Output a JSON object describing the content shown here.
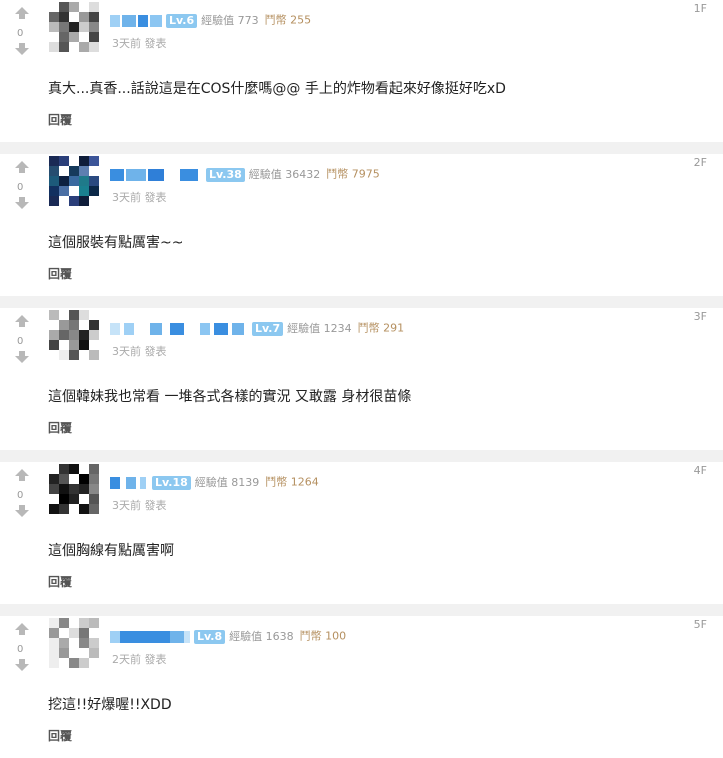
{
  "comments": [
    {
      "floor": "1F",
      "vote_count": "0",
      "level": "Lv.6",
      "exp_label": "經驗值 773",
      "gp_label": "鬥幣 255",
      "time": "3天前 發表",
      "text": "真大...真香...話說這是在COS什麼嗎@@ 手上的炸物看起來好像挺好吃xD",
      "reply": "回覆"
    },
    {
      "floor": "2F",
      "vote_count": "0",
      "level": "Lv.38",
      "exp_label": "經驗值 36432",
      "gp_label": "鬥幣 7975",
      "time": "3天前 發表",
      "text": "這個服裝有點厲害~~",
      "reply": "回覆"
    },
    {
      "floor": "3F",
      "vote_count": "0",
      "level": "Lv.7",
      "exp_label": "經驗值 1234",
      "gp_label": "鬥幣 291",
      "time": "3天前 發表",
      "text": "這個韓妹我也常看 一堆各式各樣的實況 又敢露 身材很苗條",
      "reply": "回覆"
    },
    {
      "floor": "4F",
      "vote_count": "0",
      "level": "Lv.18",
      "exp_label": "經驗值 8139",
      "gp_label": "鬥幣 1264",
      "time": "3天前 發表",
      "text": "這個胸線有點厲害啊",
      "reply": "回覆"
    },
    {
      "floor": "5F",
      "vote_count": "0",
      "level": "Lv.8",
      "exp_label": "經驗值 1638",
      "gp_label": "鬥幣 100",
      "time": "2天前 發表",
      "text": "挖這!!好爆喔!!XDD",
      "reply": "回覆"
    }
  ],
  "colors": {
    "level_badge": "#8cc8f0",
    "gp_text": "#b59060",
    "separator": "#f1f1f1"
  },
  "icons": {
    "upvote": "arrow-up-icon",
    "downvote": "arrow-down-icon"
  }
}
